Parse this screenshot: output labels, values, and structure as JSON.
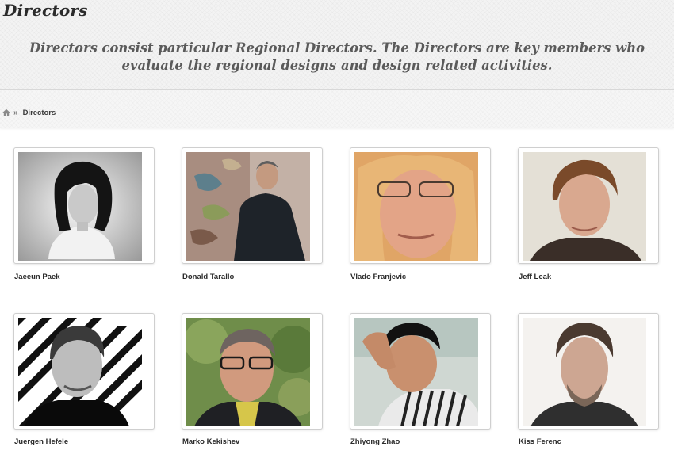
{
  "page": {
    "title": "Directors",
    "intro": "Directors consist particular Regional Directors. The Directors are key members who evaluate the regional designs and design related activities."
  },
  "breadcrumb": {
    "home_icon": "home-icon",
    "separator": "»",
    "current": "Directors"
  },
  "directors": [
    {
      "name": "Jaeeun Paek"
    },
    {
      "name": "Donald Tarallo"
    },
    {
      "name": "Vlado Franjevic"
    },
    {
      "name": "Jeff Leak"
    },
    {
      "name": "Juergen Hefele"
    },
    {
      "name": "Marko Kekishev"
    },
    {
      "name": "Zhiyong Zhao"
    },
    {
      "name": "Kiss Ferenc"
    }
  ]
}
